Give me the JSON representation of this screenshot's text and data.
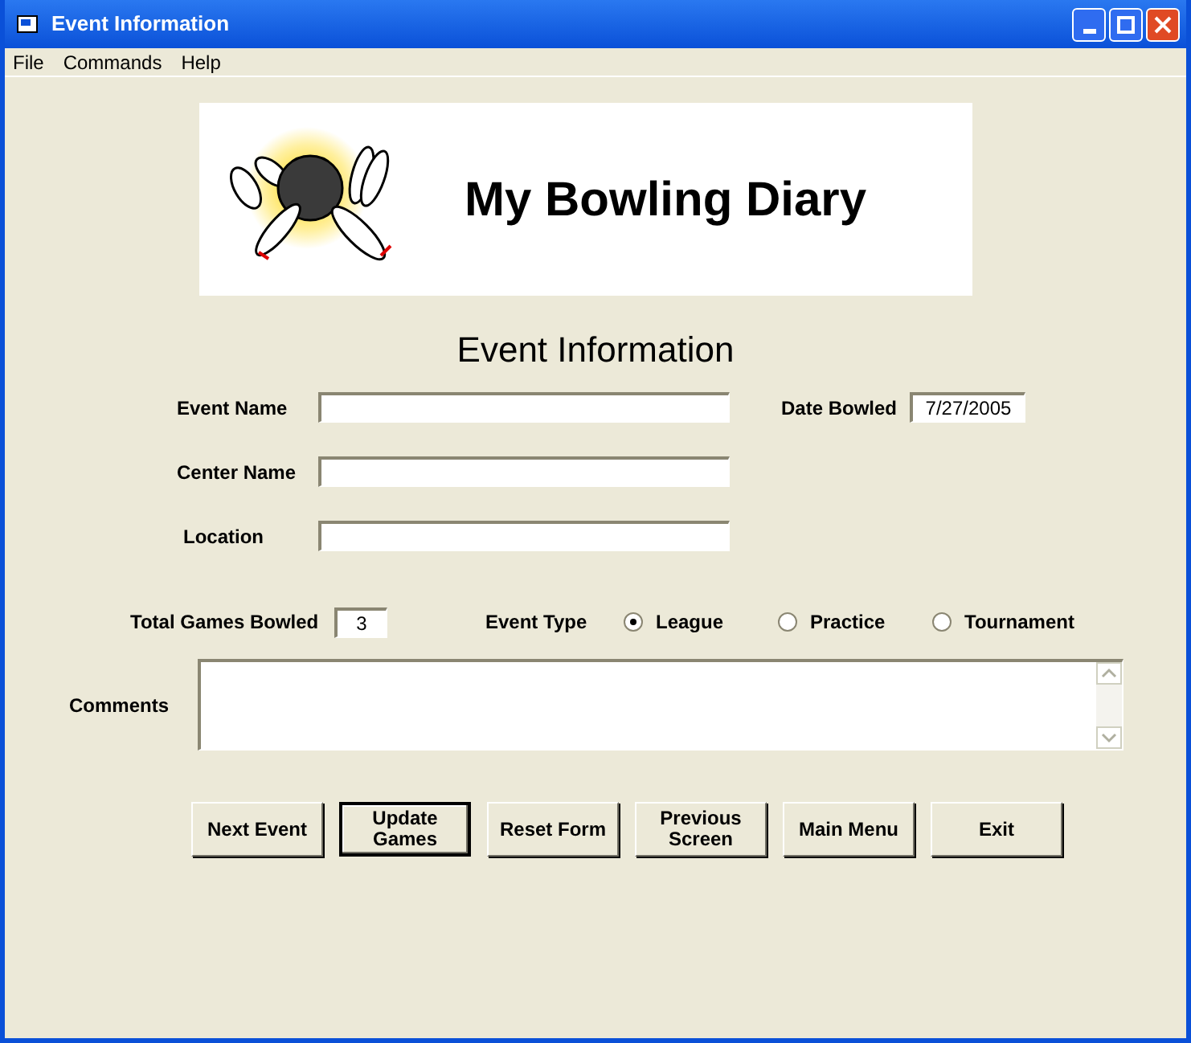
{
  "window": {
    "title": "Event Information"
  },
  "menu": [
    {
      "label": "File"
    },
    {
      "label": "Commands"
    },
    {
      "label": "Help"
    }
  ],
  "banner": {
    "title": "My Bowling Diary"
  },
  "heading": "Event Information",
  "fields": {
    "event_name": {
      "label": "Event Name"
    },
    "date_bowled": {
      "label": "Date Bowled",
      "value": "7/27/2005"
    },
    "center_name": {
      "label": "Center Name"
    },
    "location": {
      "label": "Location"
    },
    "total_games": {
      "label": "Total Games Bowled",
      "value": "3"
    },
    "comments": {
      "label": "Comments"
    }
  },
  "event_type": {
    "label": "Event Type",
    "options": [
      {
        "label": "League",
        "selected": true
      },
      {
        "label": "Practice",
        "selected": false
      },
      {
        "label": "Tournament",
        "selected": false
      }
    ]
  },
  "buttons": [
    {
      "label": "Next Event",
      "focused": false
    },
    {
      "label": "Update Games",
      "focused": true
    },
    {
      "label": "Reset Form",
      "focused": false
    },
    {
      "label": "Previous Screen",
      "focused": false
    },
    {
      "label": "Main Menu",
      "focused": false
    },
    {
      "label": "Exit",
      "focused": false
    }
  ]
}
